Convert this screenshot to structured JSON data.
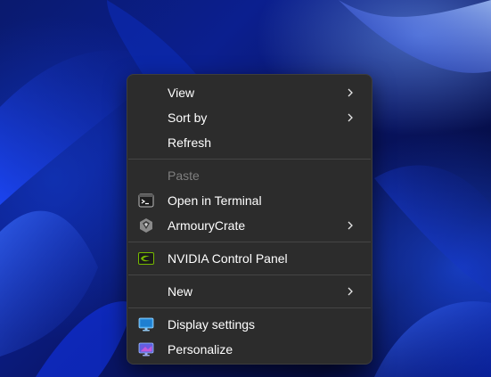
{
  "context_menu": {
    "items": [
      {
        "label": "View",
        "has_submenu": true,
        "icon": "none"
      },
      {
        "label": "Sort by",
        "has_submenu": true,
        "icon": "none"
      },
      {
        "label": "Refresh",
        "has_submenu": false,
        "icon": "none"
      },
      {
        "label": "Paste",
        "has_submenu": false,
        "icon": "none",
        "disabled": true
      },
      {
        "label": "Open in Terminal",
        "has_submenu": false,
        "icon": "terminal-icon"
      },
      {
        "label": "ArmouryCrate",
        "has_submenu": true,
        "icon": "armourycrate-icon"
      },
      {
        "label": "NVIDIA Control Panel",
        "has_submenu": false,
        "icon": "nvidia-icon"
      },
      {
        "label": "New",
        "has_submenu": true,
        "icon": "none"
      },
      {
        "label": "Display settings",
        "has_submenu": false,
        "icon": "display-settings-icon"
      },
      {
        "label": "Personalize",
        "has_submenu": false,
        "icon": "personalize-icon"
      }
    ]
  },
  "colors": {
    "menu_background": "#2c2c2c",
    "menu_text": "#ffffff",
    "disabled_text": "#7f7f7f",
    "separator": "#454545",
    "wallpaper_accent": "#1a3cff"
  }
}
